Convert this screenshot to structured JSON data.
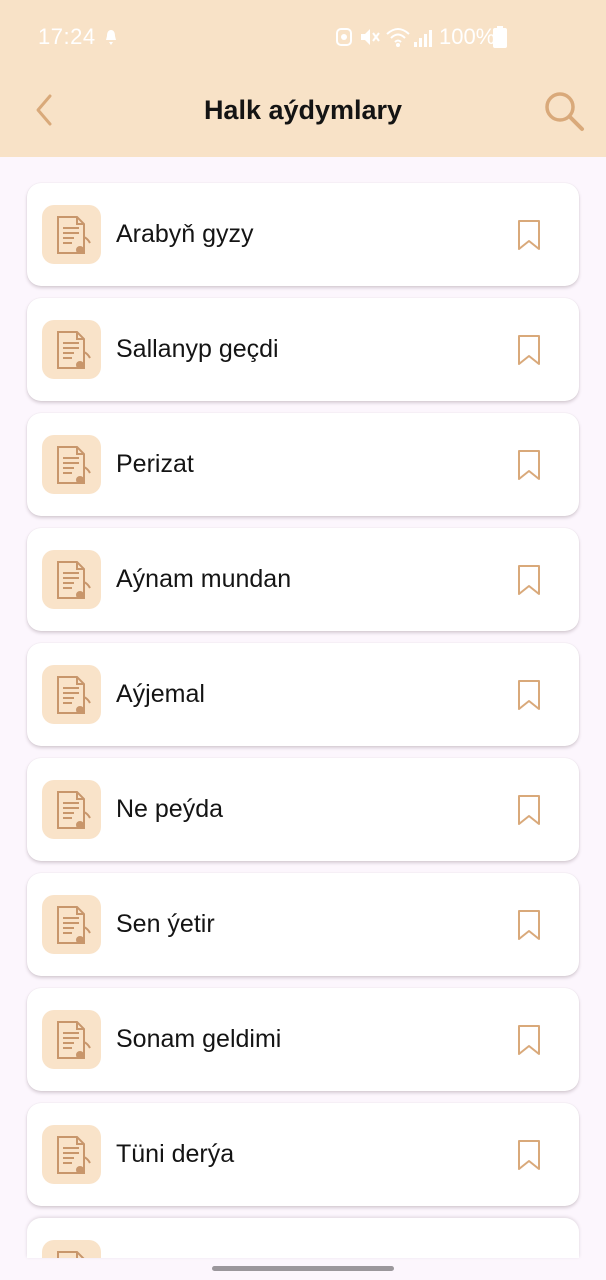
{
  "status_bar": {
    "time": "17:24",
    "battery_text": "100%",
    "icons": [
      "notification-icon",
      "alarm-icon",
      "mute-icon",
      "wifi-icon",
      "signal-icon",
      "battery-icon"
    ]
  },
  "header": {
    "title": "Halk aýdymlary",
    "back_icon": "chevron-left-icon",
    "search_icon": "search-icon",
    "background_color": "#f8e2c7",
    "accent_color": "#d9a97a"
  },
  "songs": [
    {
      "title": "Arabyň gyzy",
      "icon": "music-document-icon",
      "bookmark_icon": "bookmark-outline-icon"
    },
    {
      "title": "Sallanyp geçdi",
      "icon": "music-document-icon",
      "bookmark_icon": "bookmark-outline-icon"
    },
    {
      "title": "Perizat",
      "icon": "music-document-icon",
      "bookmark_icon": "bookmark-outline-icon"
    },
    {
      "title": "Aýnam mundan",
      "icon": "music-document-icon",
      "bookmark_icon": "bookmark-outline-icon"
    },
    {
      "title": "Aýjemal",
      "icon": "music-document-icon",
      "bookmark_icon": "bookmark-outline-icon"
    },
    {
      "title": "Ne peýda",
      "icon": "music-document-icon",
      "bookmark_icon": "bookmark-outline-icon"
    },
    {
      "title": "Sen ýetir",
      "icon": "music-document-icon",
      "bookmark_icon": "bookmark-outline-icon"
    },
    {
      "title": "Sonam geldimi",
      "icon": "music-document-icon",
      "bookmark_icon": "bookmark-outline-icon"
    },
    {
      "title": "Tüni derýa",
      "icon": "music-document-icon",
      "bookmark_icon": "bookmark-outline-icon"
    }
  ],
  "colors": {
    "page_background": "#fcf6fd",
    "card_background": "#ffffff",
    "icon_tile": "#f9e3c9",
    "icon_stroke": "#c8966b",
    "text": "#141414"
  }
}
